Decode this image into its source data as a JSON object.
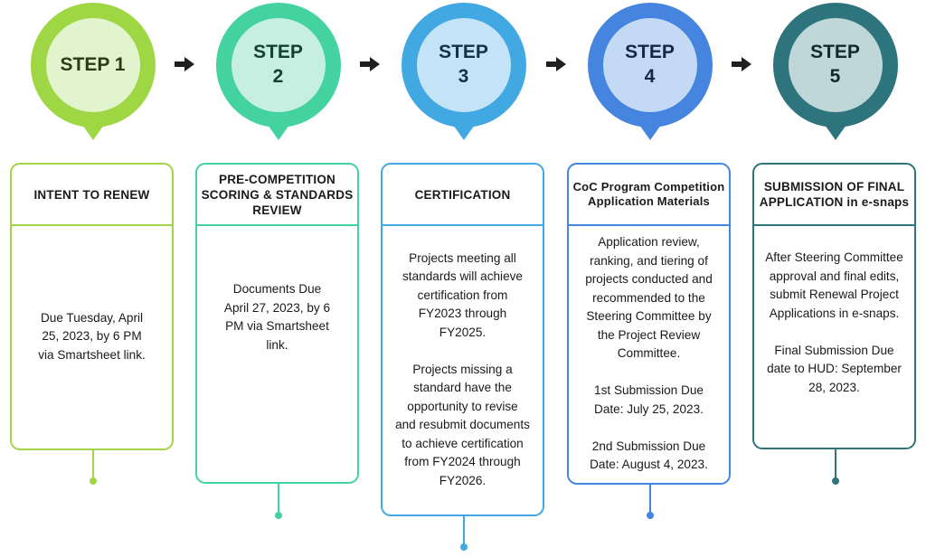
{
  "steps": [
    {
      "label": "STEP 1",
      "title": "INTENT TO RENEW",
      "body": "Due Tuesday, April\n25, 2023, by 6 PM\nvia Smartsheet link.",
      "colors": {
        "ring": "#9fd644",
        "fill": "#e2f4cd",
        "text": "#2b3a17",
        "border": "#a1d545"
      }
    },
    {
      "label": "STEP\n2",
      "title": "PRE-COMPETITION SCORING & STANDARDS REVIEW",
      "body": "Documents Due\nApril 27, 2023, by 6\nPM via Smartsheet\nlink.",
      "colors": {
        "ring": "#44d2a1",
        "fill": "#c5f0e1",
        "text": "#15402f",
        "border": "#44d2a1"
      }
    },
    {
      "label": "STEP\n3",
      "title": "CERTIFICATION",
      "body": "Projects meeting all\nstandards will achieve\ncertification from\nFY2023 through\nFY2025.\n\nProjects missing a\nstandard have the\nopportunity to revise\nand resubmit documents\nto achieve certification\nfrom FY2024 through\nFY2026.",
      "colors": {
        "ring": "#42a8e2",
        "fill": "#c3e3f6",
        "text": "#14304a",
        "border": "#42a8e2"
      }
    },
    {
      "label": "STEP\n4",
      "title": "CoC Program Competition Application Materials",
      "body": "Application review,\nranking, and tiering of\nprojects conducted and\nrecommended to the\nSteering Committee by\nthe Project Review\nCommittee.\n\n1st Submission Due\nDate: July 25, 2023.\n\n2nd Submission Due\nDate: August 4, 2023.",
      "colors": {
        "ring": "#4585df",
        "fill": "#c4d9f4",
        "text": "#14284a",
        "border": "#4585df"
      }
    },
    {
      "label": "STEP\n5",
      "title": "SUBMISSION OF FINAL APPLICATION in e-snaps",
      "body": "After Steering Committee\napproval and final edits,\nsubmit Renewal Project\nApplications in e-snaps.\n\nFinal Submission Due\ndate to HUD: September\n28, 2023.",
      "colors": {
        "ring": "#2e747c",
        "fill": "#c0d7d9",
        "text": "#132a2d",
        "border": "#2e747c"
      }
    }
  ],
  "arrow_icon": "right-arrow-icon",
  "arrow_color": "#1f1f1f"
}
